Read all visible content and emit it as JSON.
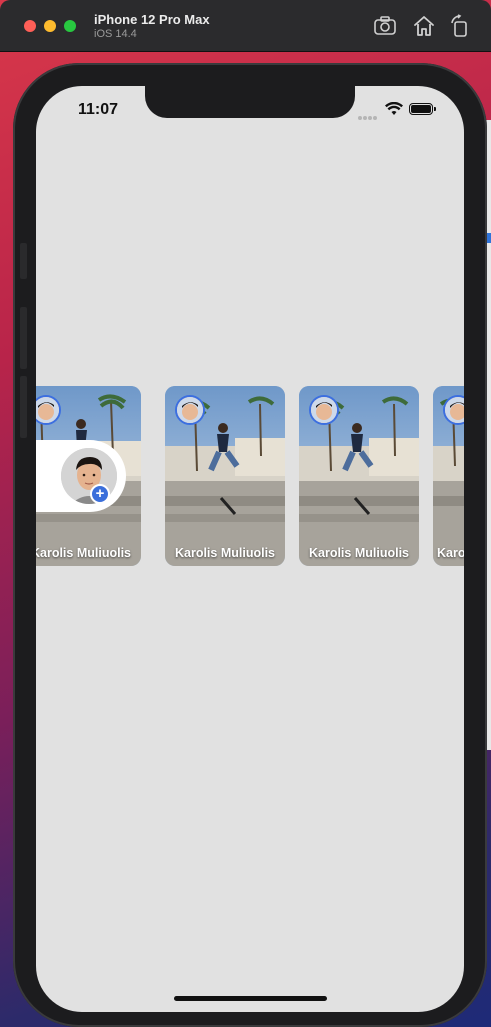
{
  "window": {
    "title": "iPhone 12 Pro Max",
    "subtitle": "iOS 14.4",
    "toolbar_icons": [
      "screenshot-icon",
      "home-icon",
      "rotate-icon"
    ]
  },
  "status_bar": {
    "time": "11:07",
    "icons": [
      "signal-dots-icon",
      "wifi-icon",
      "battery-icon"
    ]
  },
  "stories": {
    "create_story": {
      "badge": "+"
    },
    "items": [
      {
        "name": "Karolis Muliuolis"
      },
      {
        "name": "Karolis Muliuolis"
      },
      {
        "name": "Karolis Muliuolis"
      },
      {
        "name": "Karo"
      }
    ]
  },
  "colors": {
    "accent": "#3b6fdb",
    "screen_background": "#e1e1e1"
  }
}
